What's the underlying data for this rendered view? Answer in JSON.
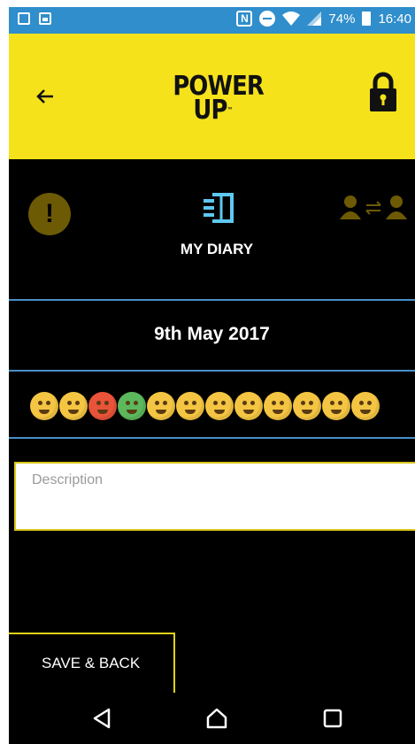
{
  "status_bar": {
    "battery_percent": "74%",
    "time": "16:40",
    "icons": [
      "sim-icon",
      "image-icon",
      "nfc-icon",
      "do-not-disturb-icon",
      "wifi-icon",
      "signal-icon",
      "battery-icon"
    ]
  },
  "header": {
    "logo_line1": "POWER",
    "logo_line2": "UP",
    "logo_tm": "™",
    "background": "#f5e21b"
  },
  "nav": {
    "diary_label": "MY DIARY",
    "alert_glyph": "!"
  },
  "entry": {
    "date": "9th May 2017",
    "description_placeholder": "Description",
    "description_value": ""
  },
  "moods": [
    {
      "name": "sleepy",
      "color": "#f4c542"
    },
    {
      "name": "angry-yellow",
      "color": "#f4c542"
    },
    {
      "name": "angry-red",
      "color": "#e8533a"
    },
    {
      "name": "sick-green",
      "color": "#5cb85c"
    },
    {
      "name": "flushed",
      "color": "#f4c542"
    },
    {
      "name": "crying",
      "color": "#f4c542"
    },
    {
      "name": "grinning",
      "color": "#f4c542"
    },
    {
      "name": "tongue-out",
      "color": "#f4c542"
    },
    {
      "name": "relieved",
      "color": "#f4c542"
    },
    {
      "name": "blushing",
      "color": "#f4c542"
    },
    {
      "name": "grimacing",
      "color": "#f4c542"
    },
    {
      "name": "screaming",
      "color": "#f4c542"
    }
  ],
  "actions": {
    "save_back_label": "SAVE & BACK"
  },
  "colors": {
    "accent_yellow": "#f5e21b",
    "divider_blue": "#4a8fc7",
    "diary_icon": "#5ec8f2",
    "status_bar": "#2f8ecb"
  }
}
